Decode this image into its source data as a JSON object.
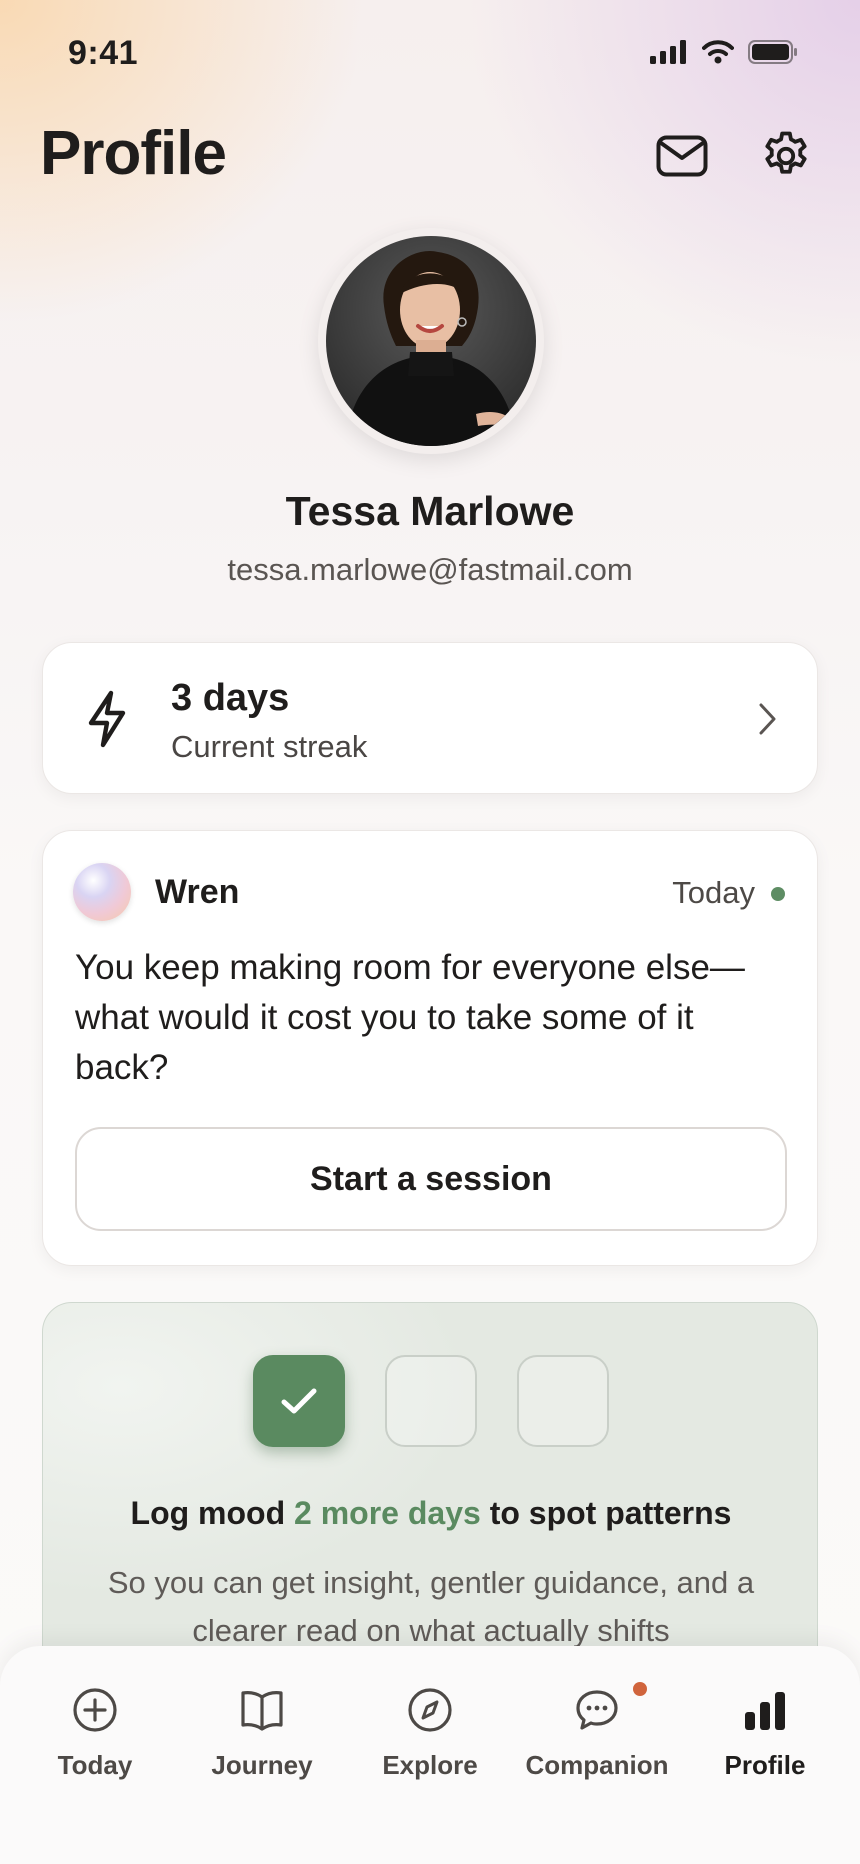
{
  "status_bar": {
    "time": "9:41"
  },
  "header": {
    "title": "Profile",
    "mail_icon": "mail-icon",
    "settings_icon": "gear-icon"
  },
  "profile": {
    "name": "Tessa Marlowe",
    "email": "tessa.marlowe@fastmail.com"
  },
  "streak": {
    "value": "3 days",
    "label": "Current streak",
    "icon": "lightning-icon"
  },
  "companion_card": {
    "name": "Wren",
    "date": "Today",
    "message": "You keep making room for everyone else—what would it cost you to take some of it back?",
    "button_label": "Start a session"
  },
  "mood_card": {
    "title_prefix": "Log mood ",
    "title_highlight": "2 more days",
    "title_suffix": " to spot patterns",
    "description": "So you can get insight, gentler guidance, and a clearer read on what actually shifts",
    "days_logged": 1,
    "days_total": 3
  },
  "tabs": [
    {
      "label": "Today",
      "icon": "plus-circle-icon"
    },
    {
      "label": "Journey",
      "icon": "book-icon"
    },
    {
      "label": "Explore",
      "icon": "compass-icon"
    },
    {
      "label": "Companion",
      "icon": "chat-bubble-icon"
    },
    {
      "label": "Profile",
      "icon": "bar-chart-icon",
      "active": true
    }
  ],
  "colors": {
    "accent_green": "#5a8a60",
    "notification": "#d0643c",
    "text": "#1f1d1c"
  }
}
